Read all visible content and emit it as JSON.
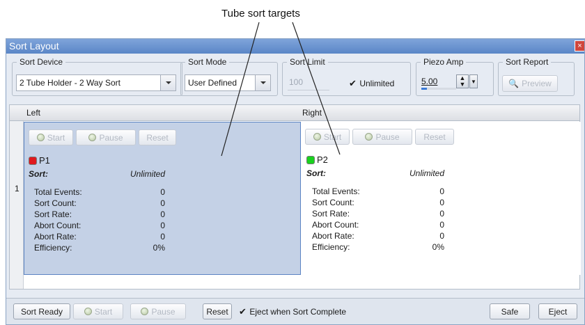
{
  "annotation": {
    "label": "Tube sort targets"
  },
  "window": {
    "title": "Sort Layout",
    "close_glyph": "×"
  },
  "sort_device": {
    "legend": "Sort Device",
    "value": "2 Tube Holder - 2 Way Sort"
  },
  "sort_mode": {
    "legend": "Sort Mode",
    "value": "User Defined"
  },
  "sort_limit": {
    "legend": "Sort Limit",
    "value": "100",
    "unlimited_label": "Unlimited",
    "unlimited_checked": true
  },
  "piezo_amp": {
    "legend": "Piezo Amp",
    "value": "5.00",
    "level_fraction": 0.15
  },
  "sort_report": {
    "legend": "Sort Report",
    "preview_label": "Preview"
  },
  "grid": {
    "columns": [
      "Left",
      "Right"
    ],
    "row_number": "1",
    "cells": [
      {
        "buttons": {
          "start": "Start",
          "pause": "Pause",
          "reset": "Reset"
        },
        "population": "P1",
        "population_color": "#e0191e",
        "sort_label": "Sort:",
        "sort_value": "Unlimited",
        "stats": [
          {
            "label": "Total Events:",
            "value": "0"
          },
          {
            "label": "Sort Count:",
            "value": "0"
          },
          {
            "label": "Sort Rate:",
            "value": "0"
          },
          {
            "label": "Abort Count:",
            "value": "0"
          },
          {
            "label": "Abort Rate:",
            "value": "0"
          },
          {
            "label": "Efficiency:",
            "value": "0%"
          }
        ]
      },
      {
        "buttons": {
          "start": "Start",
          "pause": "Pause",
          "reset": "Reset"
        },
        "population": "P2",
        "population_color": "#19d21e",
        "sort_label": "Sort:",
        "sort_value": "Unlimited",
        "stats": [
          {
            "label": "Total Events:",
            "value": "0"
          },
          {
            "label": "Sort Count:",
            "value": "0"
          },
          {
            "label": "Sort Rate:",
            "value": "0"
          },
          {
            "label": "Abort Count:",
            "value": "0"
          },
          {
            "label": "Abort Rate:",
            "value": "0"
          },
          {
            "label": "Efficiency:",
            "value": "0%"
          }
        ]
      }
    ]
  },
  "footer": {
    "sort_ready": "Sort Ready",
    "start": "Start",
    "pause": "Pause",
    "reset": "Reset",
    "eject_when_complete": "Eject when Sort Complete",
    "eject_when_complete_checked": true,
    "safe": "Safe",
    "eject": "Eject"
  }
}
